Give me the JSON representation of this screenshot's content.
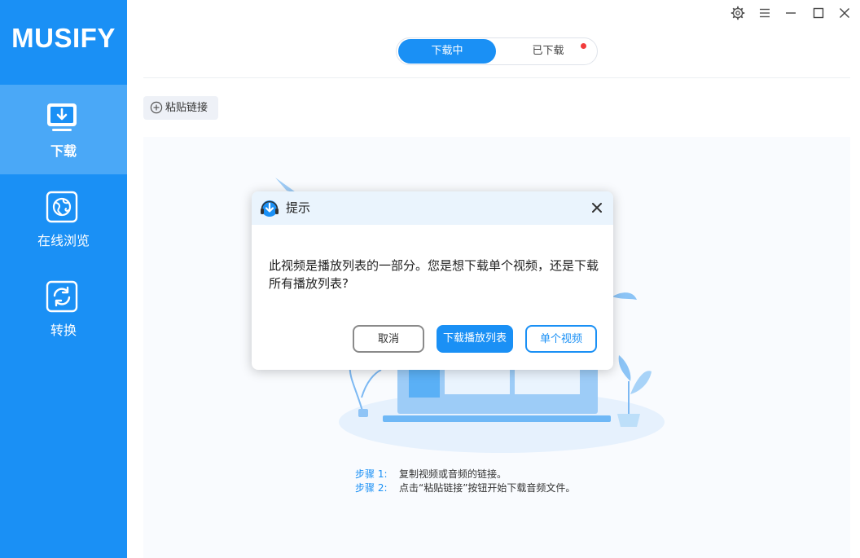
{
  "app": {
    "logo": "MUSIFY"
  },
  "sidebar": {
    "items": [
      {
        "label": "下载",
        "icon": "download-icon",
        "active": true
      },
      {
        "label": "在线浏览",
        "icon": "browse-globe-icon",
        "active": false
      },
      {
        "label": "转换",
        "icon": "convert-icon",
        "active": false
      }
    ]
  },
  "window_controls": {
    "icons": [
      "gear-icon",
      "menu-icon",
      "minimize-icon",
      "maximize-icon",
      "close-icon"
    ]
  },
  "tabs": {
    "downloading": "下载中",
    "downloaded": "已下载",
    "downloaded_has_badge": true
  },
  "toolbar": {
    "paste_label": "粘贴链接"
  },
  "steps": [
    {
      "label": "步骤 1:",
      "text": "复制视频或音频的链接。"
    },
    {
      "label": "步骤 2:",
      "text": "点击“粘贴链接”按钮开始下载音频文件。"
    }
  ],
  "dialog": {
    "title": "提示",
    "message": "此视频是播放列表的一部分。您是想下载单个视频，还是下载所有播放列表?",
    "cancel_label": "取消",
    "playlist_label": "下载播放列表",
    "single_label": "单个视频"
  },
  "colors": {
    "accent": "#1a90f5",
    "sidebar_active": "#4aa8f7",
    "badge": "#f23b3b",
    "dialog_header": "#eaf4fd"
  }
}
